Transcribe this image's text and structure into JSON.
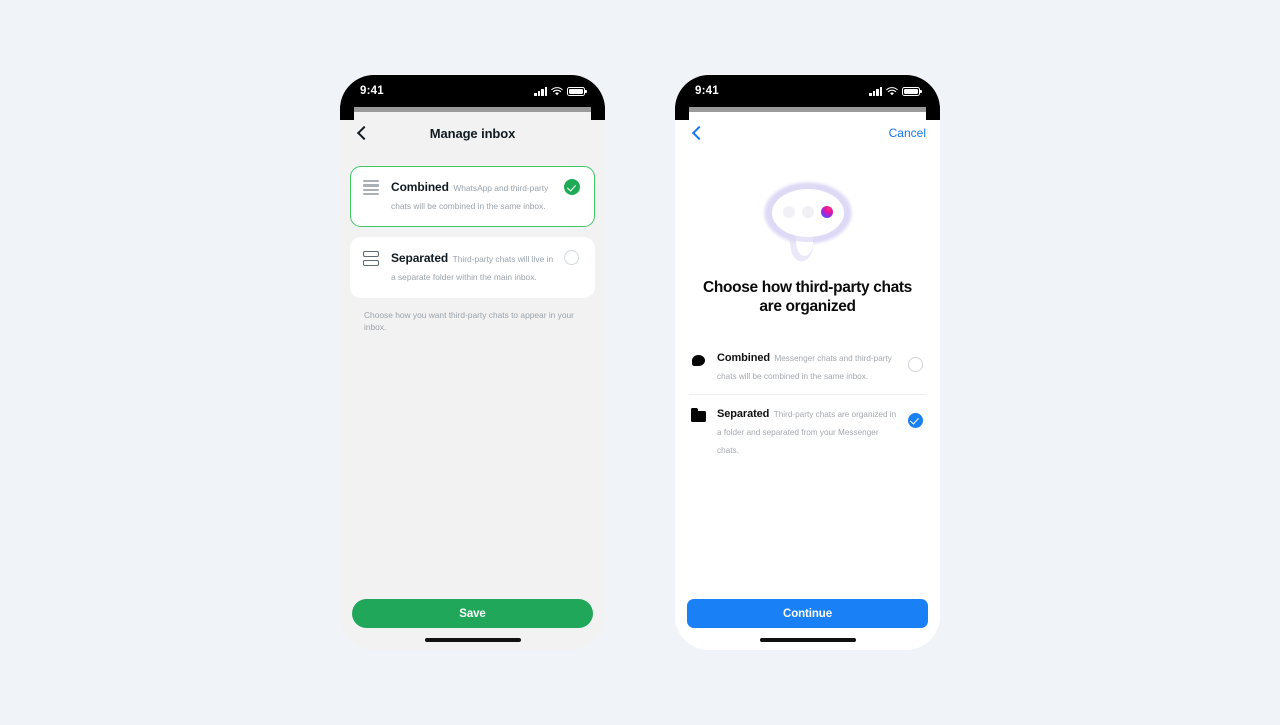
{
  "page": {
    "background_color": "#f0f4f8"
  },
  "left_phone": {
    "status_bar": {
      "time": "9:41",
      "signal_icon": "signal-bars-icon",
      "wifi_icon": "wifi-icon",
      "battery_icon": "battery-icon"
    },
    "navbar": {
      "back_icon": "chevron-left-icon",
      "title": "Manage inbox"
    },
    "options": [
      {
        "icon": "list-lines-icon",
        "title": "Combined",
        "description": "WhatsApp and third-party chats will be combined in the same inbox.",
        "selected": true,
        "control_icon": "check-circle-filled-icon"
      },
      {
        "icon": "stacked-rows-icon",
        "title": "Separated",
        "description": "Third-party chats will live in a separate folder within the main inbox.",
        "selected": false,
        "control_icon": "radio-empty-icon"
      }
    ],
    "helper_text": "Choose how you want third-party chats to appear in your inbox.",
    "primary_button": {
      "label": "Save",
      "color": "#21a759"
    },
    "home_indicator": "home-indicator"
  },
  "right_phone": {
    "status_bar": {
      "time": "9:41",
      "signal_icon": "signal-bars-icon",
      "wifi_icon": "wifi-icon",
      "battery_icon": "battery-icon"
    },
    "navbar": {
      "back_icon": "chevron-left-icon",
      "cancel_label": "Cancel",
      "accent_color": "#1877f2"
    },
    "hero": {
      "illustration": "chat-bubble-illustration",
      "title": "Choose how third-party chats are organized"
    },
    "options": [
      {
        "icon": "chat-bubble-icon",
        "title": "Combined",
        "description": "Messenger chats and third-party chats will be combined in the same inbox.",
        "selected": false,
        "control_icon": "radio-empty-icon"
      },
      {
        "icon": "folder-icon",
        "title": "Separated",
        "description": "Third-party chats are organized in a folder and separated from your Messenger chats.",
        "selected": true,
        "control_icon": "check-circle-filled-icon"
      }
    ],
    "primary_button": {
      "label": "Continue",
      "color": "#1a80f5"
    },
    "home_indicator": "home-indicator"
  }
}
